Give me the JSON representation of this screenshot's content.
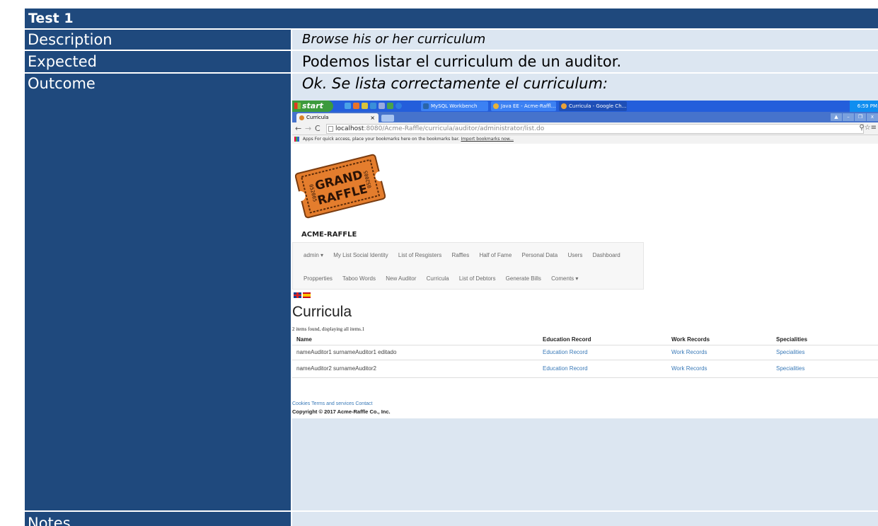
{
  "doc": {
    "title": "Test 1",
    "rows": {
      "description_label": "Description",
      "description_value": "Browse his or her curriculum",
      "expected_label": "Expected",
      "expected_value": "Podemos listar el curriculum de un auditor.",
      "outcome_label": "Outcome",
      "outcome_value": "Ok. Se lista correctamente el curriculum:",
      "notes_label": "Notes"
    }
  },
  "screenshot": {
    "taskbar": {
      "start": "start",
      "tasks": [
        "MySQL Workbench",
        "Java EE - Acme-Raffl...",
        "Curricula - Google Ch..."
      ],
      "clock": "6:59 PM"
    },
    "browser": {
      "tab_title": "Curricula",
      "url_host": "localhost",
      "url_rest": ":8080/Acme-Raffle/curricula/auditor/administrator/list.do",
      "bookmarks_text": "Apps   For quick access, place your bookmarks here on the bookmarks bar.",
      "bookmarks_link": "Import bookmarks now..."
    },
    "site": {
      "brand": "ACME-RAFFLE",
      "ticket_word1": "GRAND",
      "ticket_word2": "RAFFLE",
      "ticket_number": "052005",
      "menu_row1": [
        "admin ▾",
        "My List Social Identity",
        "List of Resgisters",
        "Raffles",
        "Half of Fame",
        "Personal Data",
        "Users",
        "Dashboard"
      ],
      "menu_row2": [
        "Propperties",
        "Taboo Words",
        "New Auditor",
        "Curricula",
        "List of Debtors",
        "Generate Bills",
        "Coments ▾"
      ],
      "heading": "Curricula",
      "items_found": "2 items found, displaying all items.1",
      "columns": [
        "Name",
        "Education Record",
        "Work Records",
        "Specialities"
      ],
      "rows": [
        [
          "nameAuditor1 surnameAuditor1 editado",
          "Education Record",
          "Work Records",
          "Specialities"
        ],
        [
          "nameAuditor2 surnameAuditor2",
          "Education Record",
          "Work Records",
          "Specialities"
        ]
      ],
      "footer_links": "Cookies Terms and services Contact",
      "copyright": "Copyright © 2017 Acme-Raffle Co., Inc."
    }
  }
}
